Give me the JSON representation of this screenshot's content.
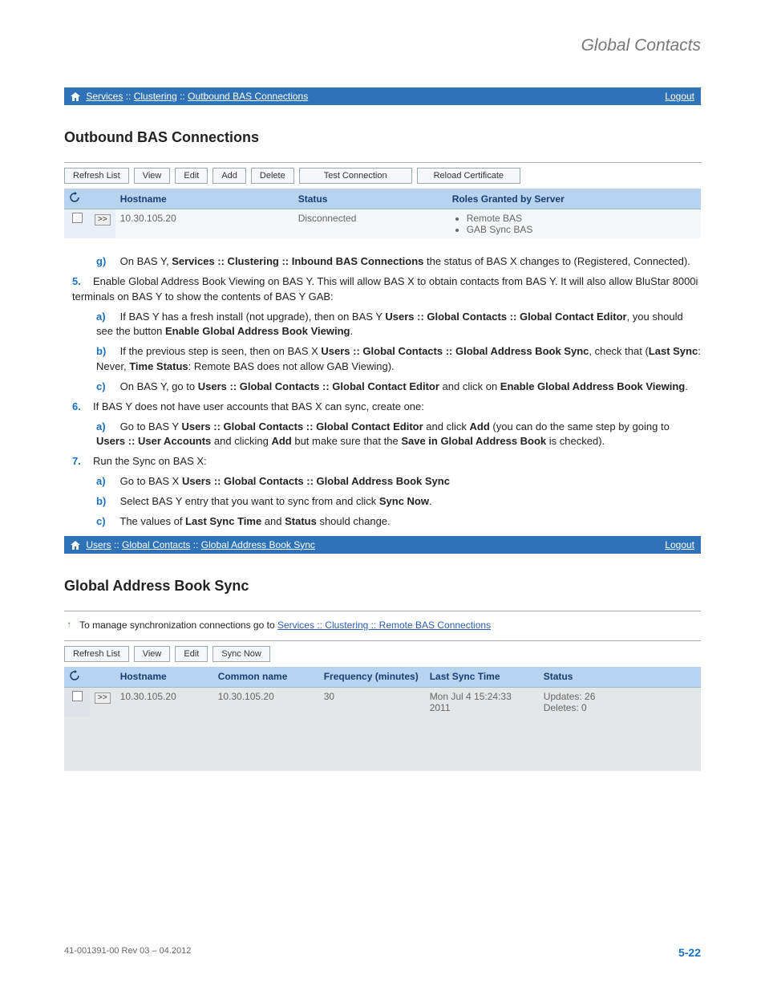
{
  "header": {
    "right_title": "Global Contacts"
  },
  "breadcrumb1": {
    "items": [
      "Services",
      "Clustering",
      "Outbound BAS Connections"
    ],
    "logout": "Logout"
  },
  "section1": {
    "title": "Outbound BAS Connections",
    "toolbar": [
      "Refresh List",
      "View",
      "Edit",
      "Add",
      "Delete",
      "Test Connection",
      "Reload Certificate"
    ],
    "columns": [
      "Hostname",
      "Status",
      "Roles Granted by Server"
    ],
    "row": {
      "hostname": "10.30.105.20",
      "status": "Disconnected",
      "roles": [
        "Remote BAS",
        "GAB Sync BAS"
      ]
    }
  },
  "instructions": {
    "g": {
      "pre": "On BAS Y, ",
      "bold": "Services :: Clustering :: Inbound BAS Connections",
      "post": " the status of BAS X changes to (Registered, Connected)."
    },
    "step5": "Enable Global Address Book Viewing on BAS Y. This will allow BAS X to obtain contacts from BAS Y. It will also allow BluStar 8000i  terminals on BAS Y to show the contents of BAS Y GAB:",
    "step5a": {
      "pre": "If BAS Y has a fresh install (not upgrade), then on BAS Y ",
      "b1": "Users :: Global Contacts :: Global Contact Editor",
      "mid": ", you should see the button ",
      "b2": "Enable Global Address Book Viewing",
      "post": "."
    },
    "step5b": {
      "pre": "If the previous step is seen, then on BAS X ",
      "b1": "Users :: Global Contacts :: Global Address Book Sync",
      "mid": ", check that (",
      "b2": "Last Sync",
      "mid2": ": Never, ",
      "b3": "Time Status",
      "post": ": Remote BAS does not allow GAB Viewing)."
    },
    "step5c": {
      "pre": "On BAS Y, go to ",
      "b1": "Users :: Global Contacts :: Global Contact Editor",
      "mid": " and click on ",
      "b2": "Enable Global Address Book Viewing",
      "post": "."
    },
    "step6": "If BAS Y does not have user accounts that BAS X can sync, create one:",
    "step6a": {
      "pre": "Go to BAS Y ",
      "b1": "Users :: Global Contacts :: Global Contact Editor",
      "mid": " and click ",
      "b2": "Add",
      "mid2": " (you can do the same step by going to ",
      "b3": "Users :: User Accounts",
      "mid3": " and clicking ",
      "b4": "Add",
      "mid4": " but make sure that the ",
      "b5": "Save in Global Address Book",
      "post": " is checked)."
    },
    "step7": "Run the Sync on BAS X:",
    "step7a": {
      "pre": "Go to BAS X ",
      "b1": "Users :: Global Contacts :: Global Address Book Sync"
    },
    "step7b": {
      "pre": "Select BAS Y entry that you want to sync from and click ",
      "b1": "Sync Now",
      "post": "."
    },
    "step7c": {
      "pre": "The values of ",
      "b1": "Last Sync Time",
      "mid": " and ",
      "b2": "Status",
      "post": " should change."
    }
  },
  "breadcrumb2": {
    "items": [
      "Users",
      "Global Contacts",
      "Global Address Book Sync"
    ],
    "logout": "Logout"
  },
  "section2": {
    "title": "Global Address Book Sync",
    "info_pre": "To manage synchronization connections go to ",
    "info_link": "Services :: Clustering :: Remote BAS Connections",
    "toolbar": [
      "Refresh List",
      "View",
      "Edit",
      "Sync Now"
    ],
    "columns": [
      "Hostname",
      "Common name",
      "Frequency (minutes)",
      "Last Sync Time",
      "Status"
    ],
    "row": {
      "hostname": "10.30.105.20",
      "common": "10.30.105.20",
      "freq": "30",
      "last": "Mon Jul 4 15:24:33 2011",
      "status1": "Updates: 26",
      "status2": "Deletes: 0"
    }
  },
  "footer": {
    "left": "41-001391-00 Rev 03 – 04.2012",
    "right": "5-22"
  }
}
